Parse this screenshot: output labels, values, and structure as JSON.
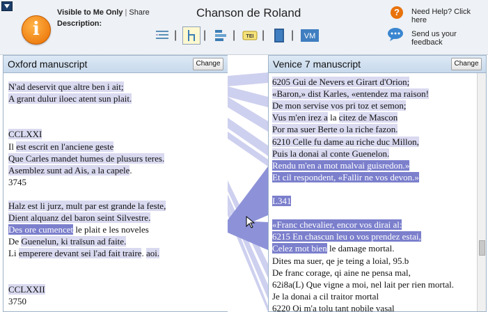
{
  "header": {
    "visibility": "Visible to Me Only",
    "share_label": "Share",
    "description_label": "Description:",
    "title": "Chanson de Roland",
    "help_text": "Need Help? Click here",
    "feedback_text": "Send us your feedback",
    "toolbar_icons": [
      "list-view-icon",
      "tree-view-icon",
      "align-view-icon",
      "tei-icon",
      "book-icon",
      "vm-icon"
    ],
    "vm_label": "VM",
    "tei_label": "TEI"
  },
  "left_panel": {
    "title": "Oxford manuscript",
    "change_label": "Change",
    "lines": [
      {
        "text": "N'ad deservit que altre ben i ait;",
        "style": "hl"
      },
      {
        "text": "A grant dulur iloec atent sun plait.",
        "style": "hl"
      },
      {
        "text": "",
        "style": "none"
      },
      {
        "text": "",
        "style": "none"
      },
      {
        "text": "CCLXXI",
        "style": "hl"
      },
      {
        "text": "Il est escrit en l'anciene geste",
        "style": "mixed",
        "segments": [
          {
            "t": "Il ",
            "s": "none"
          },
          {
            "t": "est escrit en l'anciene geste",
            "s": "hl"
          }
        ]
      },
      {
        "text": "Que Carles mandet humes de plusurs teres.",
        "style": "hl"
      },
      {
        "text": "Asemblez sunt ad Ais, a la capele.",
        "style": "mixed",
        "segments": [
          {
            "t": "Asemblez sunt ad Ais, a la ",
            "s": "hl"
          },
          {
            "t": "capele",
            "s": "hl"
          },
          {
            "t": ".",
            "s": "none"
          }
        ]
      },
      {
        "text": "3745",
        "style": "none"
      },
      {
        "text": "",
        "style": "none"
      },
      {
        "text": "Halz est li jurz, mult par est grande la feste,",
        "style": "hl"
      },
      {
        "text": "Dient alquanz del baron seint Silvestre.",
        "style": "hl"
      },
      {
        "text": "Des ore cumencet le plait e les noveles",
        "style": "mixed",
        "segments": [
          {
            "t": "Des ore cumencet",
            "s": "hls"
          },
          {
            "t": " le plait e les noveles",
            "s": "none"
          }
        ]
      },
      {
        "text": "De Guenelun, ki traïsun ad faite.",
        "style": "mixed",
        "segments": [
          {
            "t": "De ",
            "s": "none"
          },
          {
            "t": "Guenelun, ki traïsun ad faite.",
            "s": "hl"
          }
        ]
      },
      {
        "text": "Li emperere devant sei l'ad fait traire. aoi.",
        "style": "mixed",
        "segments": [
          {
            "t": "Li ",
            "s": "none"
          },
          {
            "t": "emperere devant sei l'ad fait traire",
            "s": "hl"
          },
          {
            "t": ". ",
            "s": "none"
          },
          {
            "t": "aoi.",
            "s": "hl"
          }
        ]
      },
      {
        "text": "",
        "style": "none"
      },
      {
        "text": "",
        "style": "none"
      },
      {
        "text": "CCLXXII",
        "style": "hl"
      },
      {
        "text": "3750",
        "style": "none"
      }
    ]
  },
  "right_panel": {
    "title": "Venice 7 manuscript",
    "change_label": "Change",
    "lines": [
      {
        "text": "6205 Gui de Nevers et Girart d'Orion;",
        "style": "hl"
      },
      {
        "text": "«Baron,» dist Karles, «entendez ma raison!",
        "style": "hl"
      },
      {
        "text": "De mon servise vos pri toz et semon;",
        "style": "hl"
      },
      {
        "text": "Vus m'en irez a la citez de Mascon",
        "style": "mixed",
        "segments": [
          {
            "t": "Vus m'en irez a",
            "s": "hl"
          },
          {
            "t": " la ",
            "s": "none"
          },
          {
            "t": "citez de Mascon",
            "s": "hl"
          }
        ]
      },
      {
        "text": "Por ma suer Berte o la riche fazon.",
        "style": "hl"
      },
      {
        "text": "6210 Celle fu dame au riche duc Millon,",
        "style": "hl"
      },
      {
        "text": "Puis la donai al conte Guenelon.",
        "style": "hl"
      },
      {
        "text": "Rendu m'en a mot malvai guisredon.»",
        "style": "hls"
      },
      {
        "text": "Et cil respondent, «Fallir ne vos devon.»",
        "style": "hls"
      },
      {
        "text": "",
        "style": "none"
      },
      {
        "text": "L341",
        "style": "hls"
      },
      {
        "text": "",
        "style": "none"
      },
      {
        "text": "«Franc chevalier, encor vos dirai al:",
        "style": "hls"
      },
      {
        "text": "6215 En chascun leu o vos prendez estai,",
        "style": "hls"
      },
      {
        "text": "Celez mot bien le damage mortal.",
        "style": "mixed",
        "segments": [
          {
            "t": "Celez mot bien",
            "s": "hls"
          },
          {
            "t": " le damage mortal.",
            "s": "none"
          }
        ]
      },
      {
        "text": "Dites ma suer, qe je teing a loial, 95.b",
        "style": "none"
      },
      {
        "text": "De franc corage, qi aine ne pensa mal,",
        "style": "none"
      },
      {
        "text": "62i8a(L) Que vigne a moi, nel lait per rien mortal.",
        "style": "none"
      },
      {
        "text": "Je la donai a cil traitor mortal",
        "style": "none"
      },
      {
        "text": "6220 Qi m'a tolu tant nobile vasal",
        "style": "none"
      }
    ]
  },
  "colors": {
    "highlight": "#d9d9f0",
    "selected": "#7b7fcc",
    "panel_header": "#c7d9ec",
    "link_band": "#8d92d8"
  }
}
